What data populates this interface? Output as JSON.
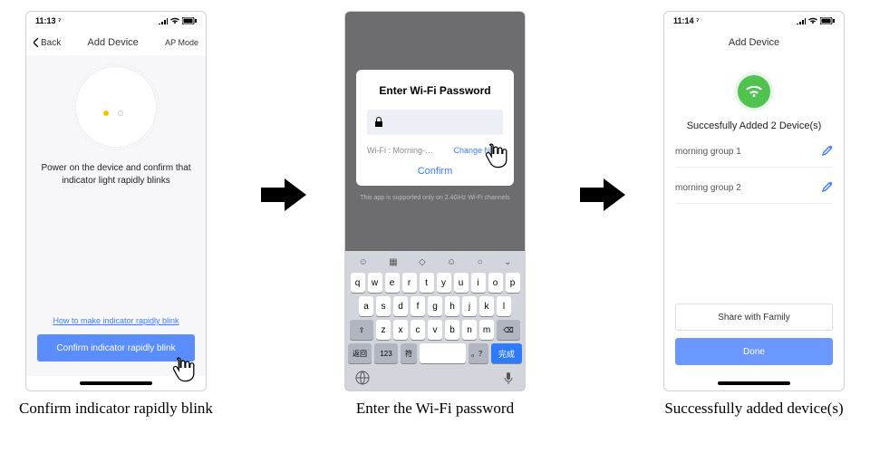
{
  "statusbar": {
    "time1": "11:13 ⁷",
    "time3": "11:14 ⁷"
  },
  "captions": {
    "c1": "Confirm indicator rapidly blink",
    "c2": "Enter the Wi-Fi password",
    "c3": "Successfully added device(s)"
  },
  "screen1": {
    "back": "Back",
    "title": "Add Device",
    "right": "AP Mode",
    "instruction": "Power on the device and confirm that indicator light rapidly blinks",
    "help_link": "How to make indicator rapidly blink",
    "cta": "Confirm indicator rapidly blink"
  },
  "screen2": {
    "dialog_title": "Enter Wi-Fi Password",
    "wifi_label": "Wi-Fi : Morning-…",
    "change": "Change Ne…",
    "confirm": "Confirm",
    "note": "This app is supported only on 2.4GHz Wi-Fi channels",
    "rows": {
      "r1": [
        "q",
        "w",
        "e",
        "r",
        "t",
        "y",
        "u",
        "i",
        "o",
        "p"
      ],
      "r2": [
        "a",
        "s",
        "d",
        "f",
        "g",
        "h",
        "j",
        "k",
        "l"
      ],
      "r3_shift": "⇧",
      "r3": [
        "z",
        "x",
        "c",
        "v",
        "b",
        "n",
        "m"
      ],
      "r3_del": "⌫",
      "r4_back": "返回",
      "r4_num": "123",
      "r4_sym": "符",
      "r4_space": "",
      "r4_punct": "。？",
      "r4_done": "完成"
    }
  },
  "screen3": {
    "title": "Add Device",
    "success": "Succesfully Added 2 Device(s)",
    "devices": [
      "morning group 1",
      "morning group 2"
    ],
    "share": "Share with Family",
    "done": "Done"
  }
}
